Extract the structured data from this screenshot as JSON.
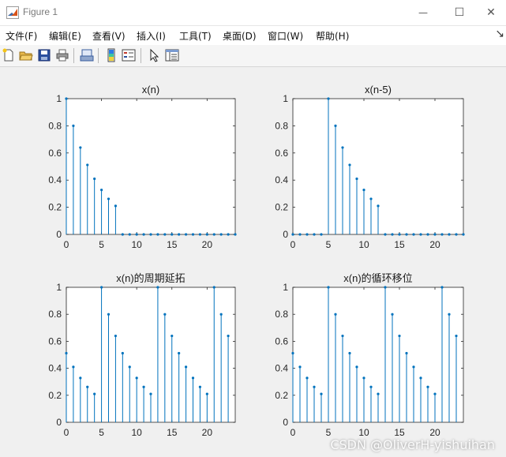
{
  "window": {
    "title": "Figure 1",
    "controls": {
      "minimize": "—",
      "maximize": "☐",
      "close": "✕"
    }
  },
  "menu": {
    "items": [
      "文件(F)",
      "编辑(E)",
      "查看(V)",
      "插入(I)",
      "工具(T)",
      "桌面(D)",
      "窗口(W)",
      "帮助(H)"
    ],
    "overflow": "↘"
  },
  "toolbar": {
    "icons": [
      "new-figure-icon",
      "open-file-icon",
      "save-icon",
      "print-icon",
      "print-preview-icon",
      "colorbar-icon",
      "legend-icon",
      "pointer-icon",
      "property-inspector-icon"
    ]
  },
  "colors": {
    "stem": "#0072bd",
    "axes_bg": "#ffffff",
    "axes_line": "#262626",
    "figure_bg": "#f0f0f0"
  },
  "watermark": "CSDN @OliverH-yishuihan",
  "chart_data": [
    {
      "type": "stem",
      "title": "x(n)",
      "xlim": [
        0,
        24
      ],
      "ylim": [
        0,
        1
      ],
      "xticks": [
        0,
        5,
        10,
        15,
        20
      ],
      "yticks": [
        0,
        0.2,
        0.4,
        0.6,
        0.8,
        1
      ],
      "ytick_labels": [
        "0",
        "0.2",
        "0.4",
        "0.6",
        "0.8",
        "1"
      ],
      "x": [
        0,
        1,
        2,
        3,
        4,
        5,
        6,
        7,
        8,
        9,
        10,
        11,
        12,
        13,
        14,
        15,
        16,
        17,
        18,
        19,
        20,
        21,
        22,
        23,
        24
      ],
      "y": [
        1,
        0.8,
        0.64,
        0.512,
        0.41,
        0.328,
        0.262,
        0.21,
        0,
        0,
        0,
        0,
        0,
        0,
        0,
        0,
        0,
        0,
        0,
        0,
        0,
        0,
        0,
        0,
        0
      ]
    },
    {
      "type": "stem",
      "title": "x(n-5)",
      "xlim": [
        0,
        24
      ],
      "ylim": [
        0,
        1
      ],
      "xticks": [
        0,
        5,
        10,
        15,
        20
      ],
      "yticks": [
        0,
        0.2,
        0.4,
        0.6,
        0.8,
        1
      ],
      "ytick_labels": [
        "0",
        "0.2",
        "0.4",
        "0.6",
        "0.8",
        "1"
      ],
      "x": [
        0,
        1,
        2,
        3,
        4,
        5,
        6,
        7,
        8,
        9,
        10,
        11,
        12,
        13,
        14,
        15,
        16,
        17,
        18,
        19,
        20,
        21,
        22,
        23,
        24
      ],
      "y": [
        0,
        0,
        0,
        0,
        0,
        1,
        0.8,
        0.64,
        0.512,
        0.41,
        0.328,
        0.262,
        0.21,
        0,
        0,
        0,
        0,
        0,
        0,
        0,
        0,
        0,
        0,
        0,
        0
      ]
    },
    {
      "type": "stem",
      "title": "x(n)的周期延拓",
      "xlim": [
        0,
        24
      ],
      "ylim": [
        0,
        1
      ],
      "xticks": [
        0,
        5,
        10,
        15,
        20
      ],
      "yticks": [
        0,
        0.2,
        0.4,
        0.6,
        0.8,
        1
      ],
      "ytick_labels": [
        "0",
        "0.2",
        "0.4",
        "0.6",
        "0.8",
        "1"
      ],
      "x": [
        0,
        1,
        2,
        3,
        4,
        5,
        6,
        7,
        8,
        9,
        10,
        11,
        12,
        13,
        14,
        15,
        16,
        17,
        18,
        19,
        20,
        21,
        22,
        23
      ],
      "y": [
        0.512,
        0.41,
        0.328,
        0.262,
        0.21,
        1,
        0.8,
        0.64,
        0.512,
        0.41,
        0.328,
        0.262,
        0.21,
        1,
        0.8,
        0.64,
        0.512,
        0.41,
        0.328,
        0.262,
        0.21,
        1,
        0.8,
        0.64
      ]
    },
    {
      "type": "stem",
      "title": "x(n)的循环移位",
      "xlim": [
        0,
        24
      ],
      "ylim": [
        0,
        1
      ],
      "xticks": [
        0,
        5,
        10,
        15,
        20
      ],
      "yticks": [
        0,
        0.2,
        0.4,
        0.6,
        0.8,
        1
      ],
      "ytick_labels": [
        "0",
        "0.2",
        "0.4",
        "0.6",
        "0.8",
        "1"
      ],
      "x": [
        0,
        1,
        2,
        3,
        4,
        5,
        6,
        7,
        8,
        9,
        10,
        11,
        12,
        13,
        14,
        15,
        16,
        17,
        18,
        19,
        20,
        21,
        22,
        23
      ],
      "y": [
        0.512,
        0.41,
        0.328,
        0.262,
        0.21,
        1,
        0.8,
        0.64,
        0.512,
        0.41,
        0.328,
        0.262,
        0.21,
        1,
        0.8,
        0.64,
        0.512,
        0.41,
        0.328,
        0.262,
        0.21,
        1,
        0.8,
        0.64
      ]
    }
  ]
}
